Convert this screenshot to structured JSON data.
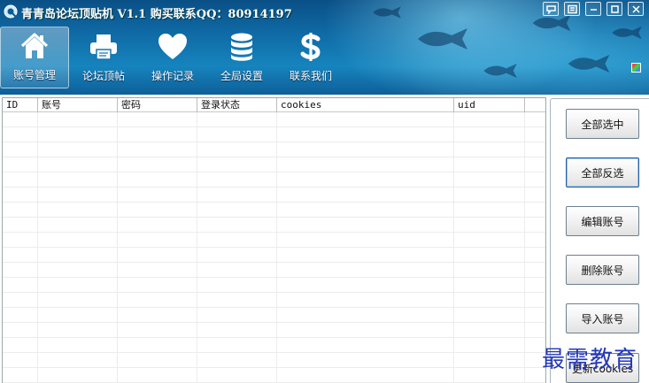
{
  "window": {
    "title": "青青岛论坛顶贴机 V1.1 购买联系QQ：80914197",
    "logo_icon": "app-logo-icon",
    "controls": [
      "feedback-icon",
      "menu-icon",
      "minimize-icon",
      "maximize-icon",
      "close-icon"
    ]
  },
  "toolbar": {
    "items": [
      {
        "label": "账号管理",
        "icon": "house-icon",
        "active": true
      },
      {
        "label": "论坛顶帖",
        "icon": "printer-icon",
        "active": false
      },
      {
        "label": "操作记录",
        "icon": "heart-icon",
        "active": false
      },
      {
        "label": "全局设置",
        "icon": "database-icon",
        "active": false
      },
      {
        "label": "联系我们",
        "icon": "dollar-icon",
        "active": false
      }
    ],
    "skin_icon": "palette-icon"
  },
  "table": {
    "columns": [
      "ID",
      "账号",
      "密码",
      "登录状态",
      "cookies",
      "uid"
    ],
    "rows": []
  },
  "sidebar": {
    "buttons": [
      {
        "label": "全部选中",
        "focused": false
      },
      {
        "label": "全部反选",
        "focused": true
      },
      {
        "label": "编辑账号",
        "focused": false
      },
      {
        "label": "删除账号",
        "focused": false
      },
      {
        "label": "导入账号",
        "focused": false
      },
      {
        "label": "更新cookies",
        "focused": false
      }
    ]
  },
  "watermark": "最需教育",
  "colors": {
    "header_top": "#0a4f86",
    "header_mid": "#1684bd",
    "watermark": "#2338b8",
    "button_border": "#6e7f8f",
    "focus_border": "#2a5f9e"
  }
}
